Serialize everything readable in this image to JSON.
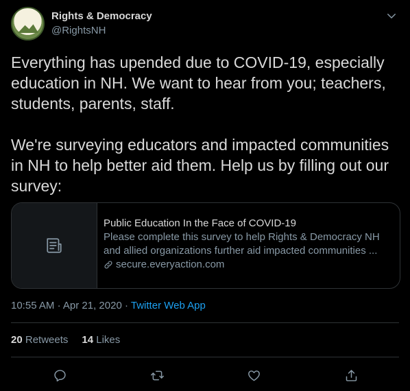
{
  "user": {
    "display_name": "Rights & Democracy",
    "handle": "@RightsNH"
  },
  "tweet": {
    "text": "Everything has upended due to COVID-19, especially education in NH. We want to hear from you; teachers, students, parents, staff.\n\nWe're surveying educators and impacted communities in NH to help better aid them. Help us by filling out our survey:"
  },
  "card": {
    "title": "Public Education In the Face of COVID-19",
    "description_line1": "Please complete this survey to help Rights & Democracy NH",
    "description_line2": "and allied organizations further aid impacted communities ...",
    "domain": "secure.everyaction.com"
  },
  "meta": {
    "time": "10:55 AM",
    "separator1": "·",
    "date": "Apr 21, 2020",
    "separator2": "·",
    "source": "Twitter Web App"
  },
  "stats": {
    "retweets_count": "20",
    "retweets_label": "Retweets",
    "likes_count": "14",
    "likes_label": "Likes"
  },
  "colors": {
    "background": "#000000",
    "text": "#d9d9d9",
    "secondary": "#8899a6",
    "accent": "#1da1f2",
    "border": "#2f3336"
  }
}
